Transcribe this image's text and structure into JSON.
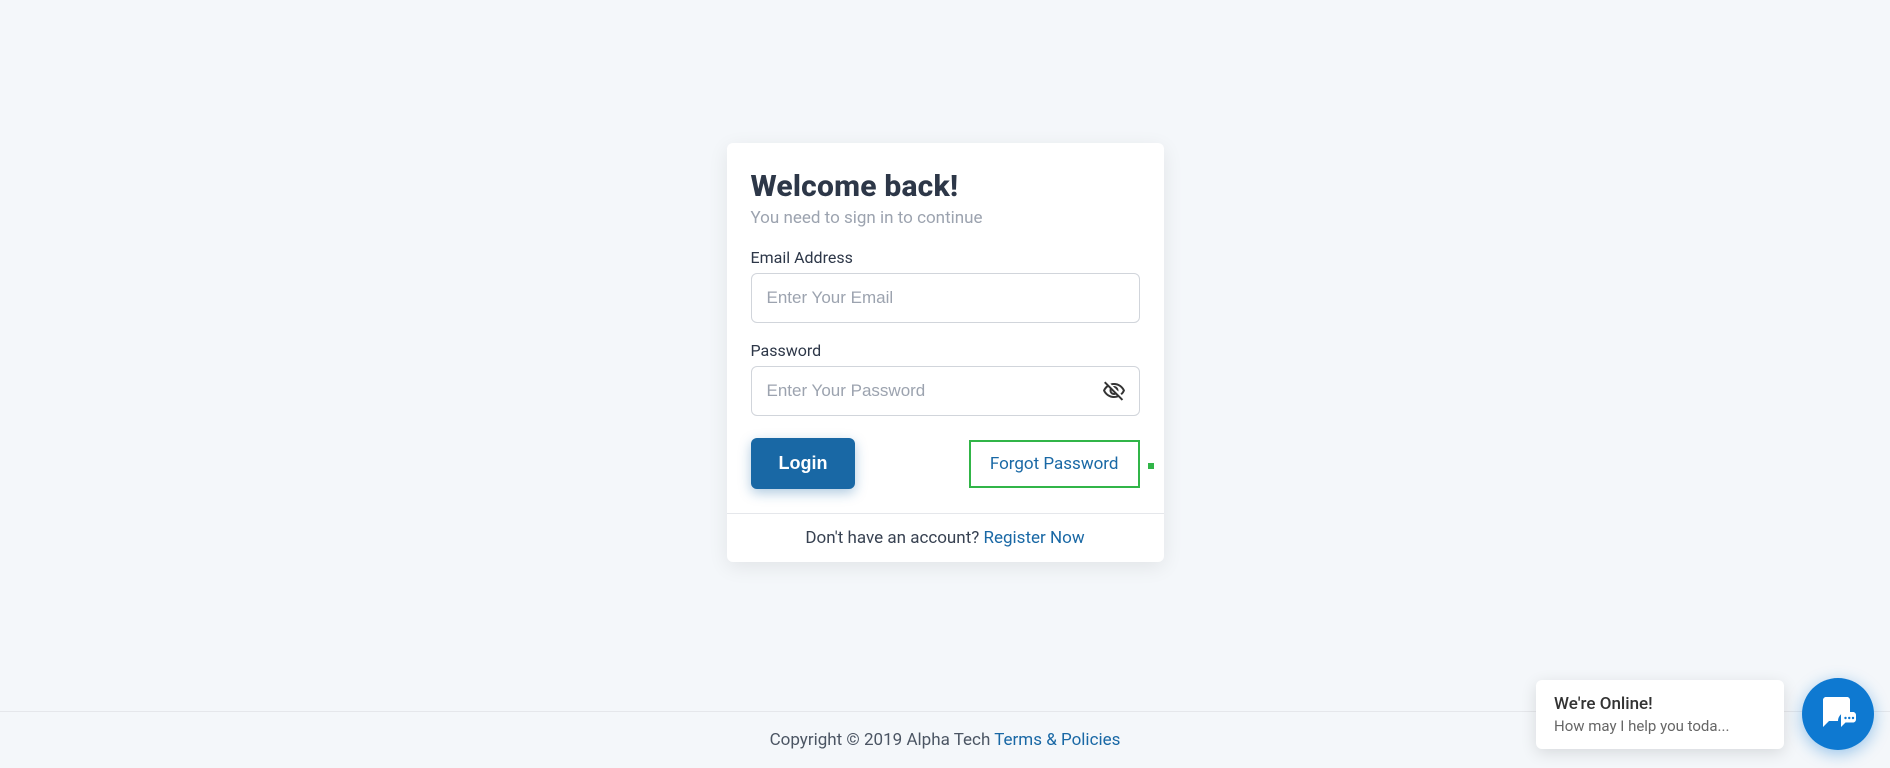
{
  "header": {
    "title": "Welcome back!",
    "subtitle": "You need to sign in to continue"
  },
  "form": {
    "email": {
      "label": "Email Address",
      "placeholder": "Enter Your Email",
      "value": ""
    },
    "password": {
      "label": "Password",
      "placeholder": "Enter Your Password",
      "value": ""
    },
    "login_button": "Login",
    "forgot_link": "Forgot Password"
  },
  "footer": {
    "account_prompt": "Don't have an account? ",
    "register_link": "Register Now"
  },
  "page_footer": {
    "copyright": "Copyright © 2019 Alpha Tech ",
    "terms_link": "Terms & Policies"
  },
  "chat": {
    "title": "We're Online!",
    "subtitle": "How may I help you toda..."
  }
}
